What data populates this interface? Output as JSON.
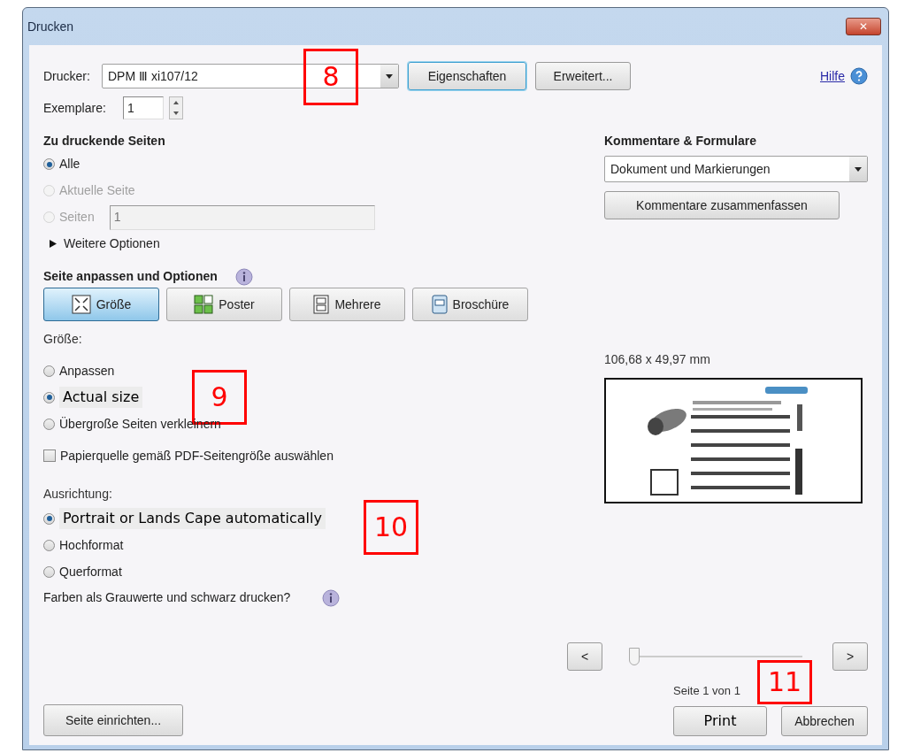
{
  "window": {
    "title": "Drucken",
    "close": "✕"
  },
  "printer": {
    "label": "Drucker:",
    "value": "DPM Ⅲ xi107/12",
    "callout": "8"
  },
  "top_buttons": [
    {
      "label": "Eigenschaften",
      "focused": true
    },
    {
      "label": "Erweitert...",
      "focused": false
    }
  ],
  "help": {
    "label": "Hilfe"
  },
  "copies": {
    "label": "Exemplare:",
    "value": "1"
  },
  "pages": {
    "title": "Zu druckende Seiten",
    "options": [
      {
        "label": "Alle",
        "selected": true,
        "disabled": false
      },
      {
        "label": "Aktuelle Seite",
        "selected": false,
        "disabled": true
      },
      {
        "label": "Seiten",
        "selected": false,
        "disabled": true,
        "field": "1"
      }
    ],
    "more": {
      "label": "Weitere Optionen",
      "expanded": false
    }
  },
  "fit": {
    "title": "Seite anpassen und Optionen",
    "modes": [
      {
        "label": "Größe",
        "selected": true,
        "kind": "size"
      },
      {
        "label": "Poster",
        "selected": false,
        "kind": "poster"
      },
      {
        "label": "Mehrere",
        "selected": false,
        "kind": "multiple"
      },
      {
        "label": "Broschüre",
        "selected": false,
        "kind": "booklet"
      }
    ],
    "size_label": "Größe:",
    "size_options": [
      {
        "label": "Anpassen",
        "selected": false,
        "kind": "native"
      },
      {
        "label": "Actual size",
        "selected": true,
        "kind": "pasted",
        "callout": "9"
      },
      {
        "label": "Übergroße Seiten verkleinern",
        "selected": false,
        "kind": "native"
      }
    ],
    "paper_source": {
      "label": "Papierquelle gemäß PDF-Seitengröße auswählen",
      "checked": false
    }
  },
  "orientation": {
    "label": "Ausrichtung:",
    "options": [
      {
        "label": "Portrait or Lands Cape automatically",
        "selected": true,
        "kind": "pasted",
        "callout": "10"
      },
      {
        "label": "Hochformat",
        "selected": false,
        "kind": "native"
      },
      {
        "label": "Querformat",
        "selected": false,
        "kind": "native"
      }
    ]
  },
  "grayscale": {
    "label": "Farben als Grauwerte und schwarz drucken?"
  },
  "comments": {
    "title": "Kommentare & Formulare",
    "value": "Dokument und Markierungen",
    "button": "Kommentare zusammenfassen"
  },
  "preview": {
    "dimensions": "106,68 x 49,97 mm"
  },
  "navigation": {
    "prev": "<",
    "next": ">",
    "level": 0,
    "page_text": "Seite 1 von 1",
    "callout": "11"
  },
  "footer": {
    "setup": "Seite einrichten...",
    "print": "Print",
    "cancel": "Abbrechen"
  }
}
